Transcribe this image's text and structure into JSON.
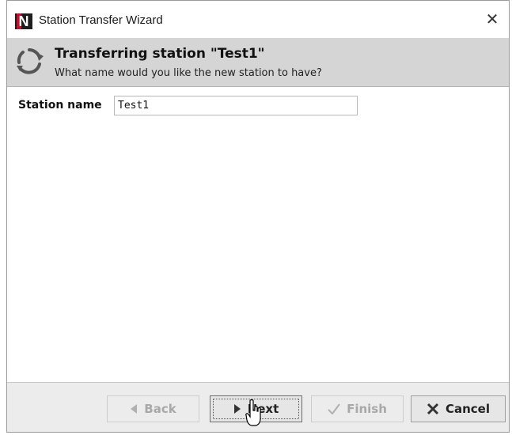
{
  "window": {
    "title": "Station Transfer Wizard",
    "close_symbol": "✕",
    "app_icon_letter": "N"
  },
  "header": {
    "title": "Transferring station \"Test1\"",
    "subtitle": "What name would you like the new station to have?",
    "icon": "refresh-icon"
  },
  "form": {
    "station_name_label": "Station name",
    "station_name_value": "Test1"
  },
  "buttons": {
    "back": {
      "label": "Back",
      "icon": "triangle-left-icon",
      "enabled": false
    },
    "next": {
      "label": "Next",
      "icon": "triangle-right-icon",
      "enabled": true,
      "focused": true
    },
    "finish": {
      "label": "Finish",
      "icon": "checkmark-icon",
      "enabled": false
    },
    "cancel": {
      "label": "Cancel",
      "icon": "x-icon",
      "enabled": true
    }
  },
  "colors": {
    "banner_bg": "#d5d5d5",
    "footer_bg": "#ececec",
    "logo_red": "#c8102e",
    "disabled_text": "#a8a8a8"
  }
}
